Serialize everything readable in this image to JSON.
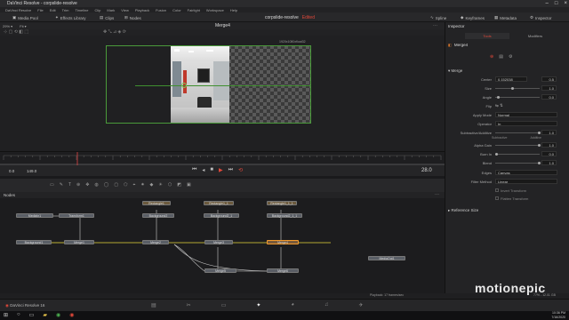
{
  "window": {
    "title": "DaVinci Resolve - corpslide-resolve"
  },
  "menubar": {
    "items": [
      "DaVinci Resolve",
      "File",
      "Edit",
      "Trim",
      "Timeline",
      "Clip",
      "Mark",
      "View",
      "Playback",
      "Fusion",
      "Color",
      "Fairlight",
      "Workspace",
      "Help"
    ]
  },
  "toolbar": {
    "media_pool": "Media Pool",
    "effects_library": "Effects Library",
    "clips": "Clips",
    "nodes": "Nodes",
    "project_title": "corpslide-resolve",
    "edited_label": "Edited",
    "spline": "Spline",
    "keyframes": "Keyframes",
    "metadata": "Metadata",
    "inspector": "Inspector"
  },
  "viewer": {
    "zoom": "29% ▾",
    "fit": "Fit ▾",
    "title": "Merge4",
    "resolution": "1920x1080xfloat32"
  },
  "transport": {
    "start": "0.0",
    "end": "149.0",
    "current": "28.0"
  },
  "nodes_panel": {
    "label": "Nodes",
    "nodes": [
      {
        "label": "MediaIn1"
      },
      {
        "label": "Transform1"
      },
      {
        "label": "Background1"
      },
      {
        "label": "Merge1"
      },
      {
        "label": "Rectangle1"
      },
      {
        "label": "Background2"
      },
      {
        "label": "Merge2"
      },
      {
        "label": "Rectangle1_1"
      },
      {
        "label": "Background2_1"
      },
      {
        "label": "Merge3"
      },
      {
        "label": "Rectangle1_1_1"
      },
      {
        "label": "Background2_1_1"
      },
      {
        "label": "Merge4"
      },
      {
        "label": "Merge5"
      },
      {
        "label": "Merge6"
      },
      {
        "label": "MediaOut1"
      }
    ]
  },
  "inspector": {
    "title": "Inspector",
    "tabs": [
      "Tools",
      "Modifiers"
    ],
    "node_name": "Merge4",
    "section": "Merge",
    "fields": [
      {
        "label": "Center",
        "x": "0.152038",
        "y": "0.5"
      },
      {
        "label": "Size",
        "value": "1.0"
      },
      {
        "label": "Angle",
        "value": "0.0"
      },
      {
        "label": "Flip"
      },
      {
        "label": "Apply Mode",
        "select": "Normal"
      },
      {
        "label": "Operator",
        "select": "In"
      },
      {
        "label": "Subtractive/Additive",
        "value": "1.0",
        "left": "Subtractive",
        "right": "Additive"
      },
      {
        "label": "Alpha Gain",
        "value": "1.0"
      },
      {
        "label": "Burn In",
        "value": "0.0"
      },
      {
        "label": "Blend",
        "value": "1.0"
      },
      {
        "label": "Edges",
        "select": "Canvas"
      },
      {
        "label": "Filter Method",
        "select": "Linear"
      }
    ],
    "checkboxes": [
      "Invert Transform",
      "Flatten Transform"
    ],
    "reference_size": "Reference Size"
  },
  "status": {
    "playback": "Playback: 17 frames/sec",
    "memory": "77% - 12.01 GB"
  },
  "app_footer": {
    "name": "DaVinci Resolve 16"
  },
  "watermark": "motionepic",
  "taskbar": {
    "time": "10:36 PM",
    "date": "7/16/2020"
  }
}
